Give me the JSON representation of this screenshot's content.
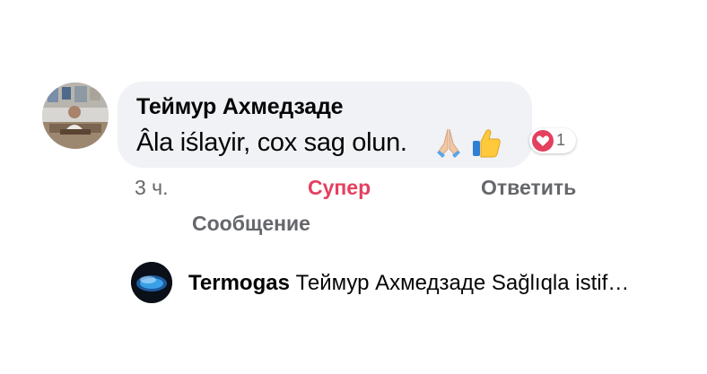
{
  "comment": {
    "author": "Теймур Ахмедзаде",
    "text": "Âla iślayir, cox sag olun.",
    "emojis": [
      "folded-hands-icon",
      "thumbs-up-icon"
    ],
    "reaction": {
      "icon": "heart-icon",
      "count": "1",
      "color": "#e4405f"
    }
  },
  "actions": {
    "timestamp": "3 ч.",
    "super_label": "Супер",
    "reply_label": "Ответить",
    "message_label": "Сообщение"
  },
  "reply_preview": {
    "author": "Termogas",
    "text": "Теймур Ахмедзаде Sağlıqla istif…"
  },
  "colors": {
    "bubble": "#f0f2f5",
    "meta_text": "#65676b",
    "accent_super": "#e4405f"
  }
}
